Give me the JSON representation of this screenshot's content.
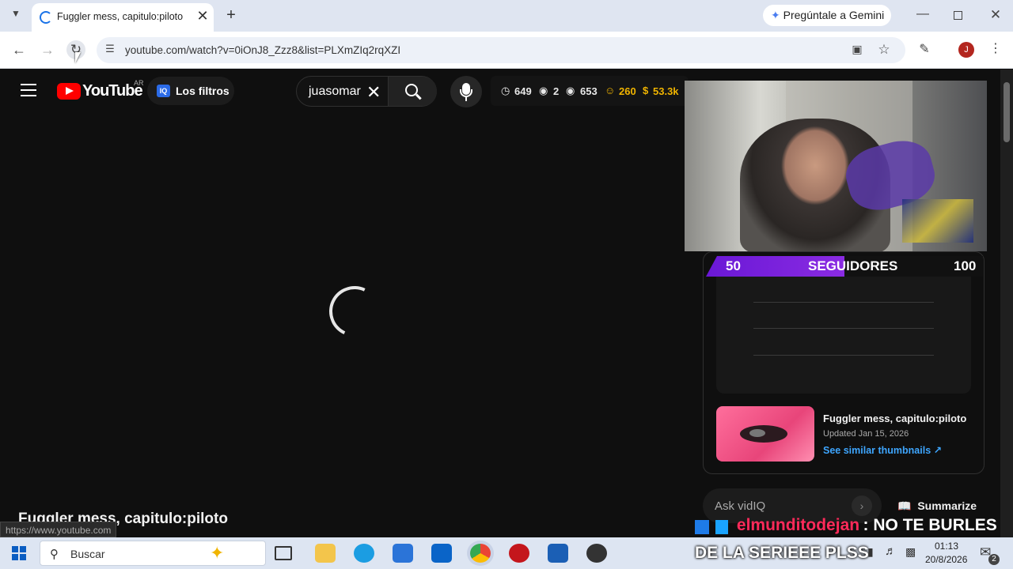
{
  "browser": {
    "tab_title": "Fuggler mess, capitulo:piloto - ",
    "new_tab": "+",
    "gemini_button": "Pregúntale a Gemini",
    "url": "youtube.com/watch?v=0iOnJ8_Zzz8&list=PLXmZIq2rqXZI",
    "profile_initial": "J",
    "status_url": "https://www.youtube.com"
  },
  "youtube": {
    "logo_text": "YouTube",
    "country_code": "AR",
    "filters_icon": "IQ",
    "filters_label": "Los filtros",
    "search_query": "juasomar",
    "stats": {
      "time": "649",
      "views_small": "2",
      "views": "653",
      "subs": "260",
      "earnings": "53.3k"
    },
    "video_title": "Fuggler mess, capitulo:piloto"
  },
  "vidiq_panel": {
    "video_title": "Fuggler mess, capitulo:piloto",
    "updated": "Updated Jan 15, 2026",
    "similar_link": "See similar thumbnails",
    "ask_placeholder": "Ask vidIQ",
    "summarize_label": "Summarize"
  },
  "stream_overlay": {
    "follow_current": "50",
    "follow_label": "SEGUIDORES",
    "follow_goal": "100",
    "goal_progress_fraction": 0.5,
    "chat_user": "elmunditodejan",
    "chat_message_1": ": NO TE BURLES",
    "chat_message_2": "DE LA SERIEEE PLSS"
  },
  "taskbar": {
    "search_placeholder": "Buscar",
    "time": "01:13",
    "date": "20/8/2026",
    "notifications": "2"
  }
}
